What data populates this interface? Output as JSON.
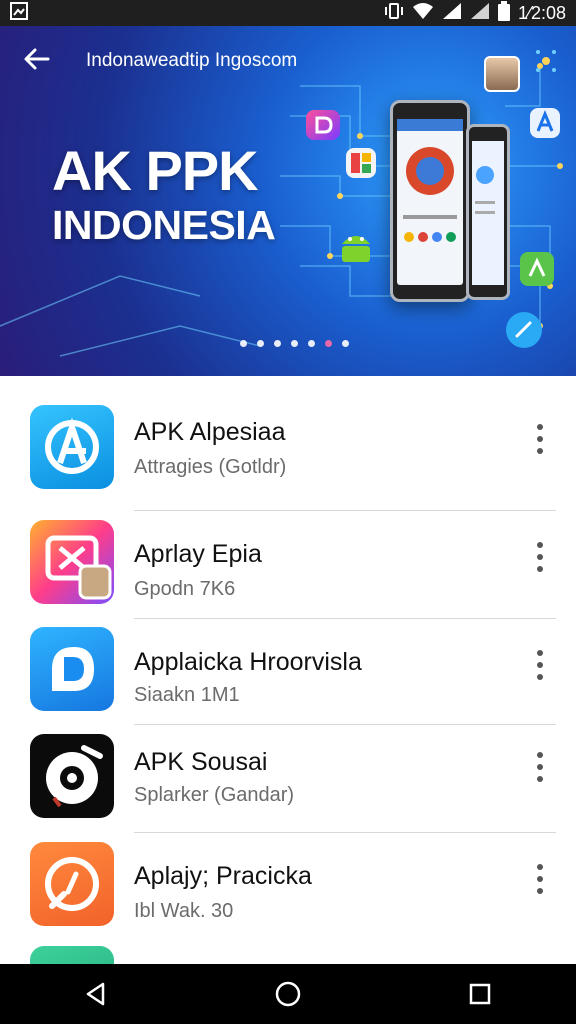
{
  "status_bar": {
    "time": "1⁄2:08"
  },
  "hero": {
    "url": "Indonaweadtip Ingoscom",
    "title_line1": "AK PPK",
    "title_line2": "INDONESIA",
    "carousel": {
      "count": 7,
      "active_index": 5
    }
  },
  "apps": [
    {
      "name": "APK Alpesiaa",
      "subtitle": "Attragies (Gotldr)",
      "icon": "app-icon-blue-a"
    },
    {
      "name": "Aprlay Epia",
      "subtitle": "Gpodn 7K6",
      "icon": "app-icon-gradient-x"
    },
    {
      "name": "Applaicka Hroorvisla",
      "subtitle": "Siaakn 1M1",
      "icon": "app-icon-blue-d"
    },
    {
      "name": "APK Sousai",
      "subtitle": "Splarker (Gandar)",
      "icon": "app-icon-black-disc"
    },
    {
      "name": "Aplajy; Pracicka",
      "subtitle": "Ibl Wak. 30",
      "icon": "app-icon-orange"
    }
  ],
  "colors": {
    "hero_bg": "#1b4fc4",
    "active_dot": "#ff6aa8",
    "navbar": "#000000"
  }
}
